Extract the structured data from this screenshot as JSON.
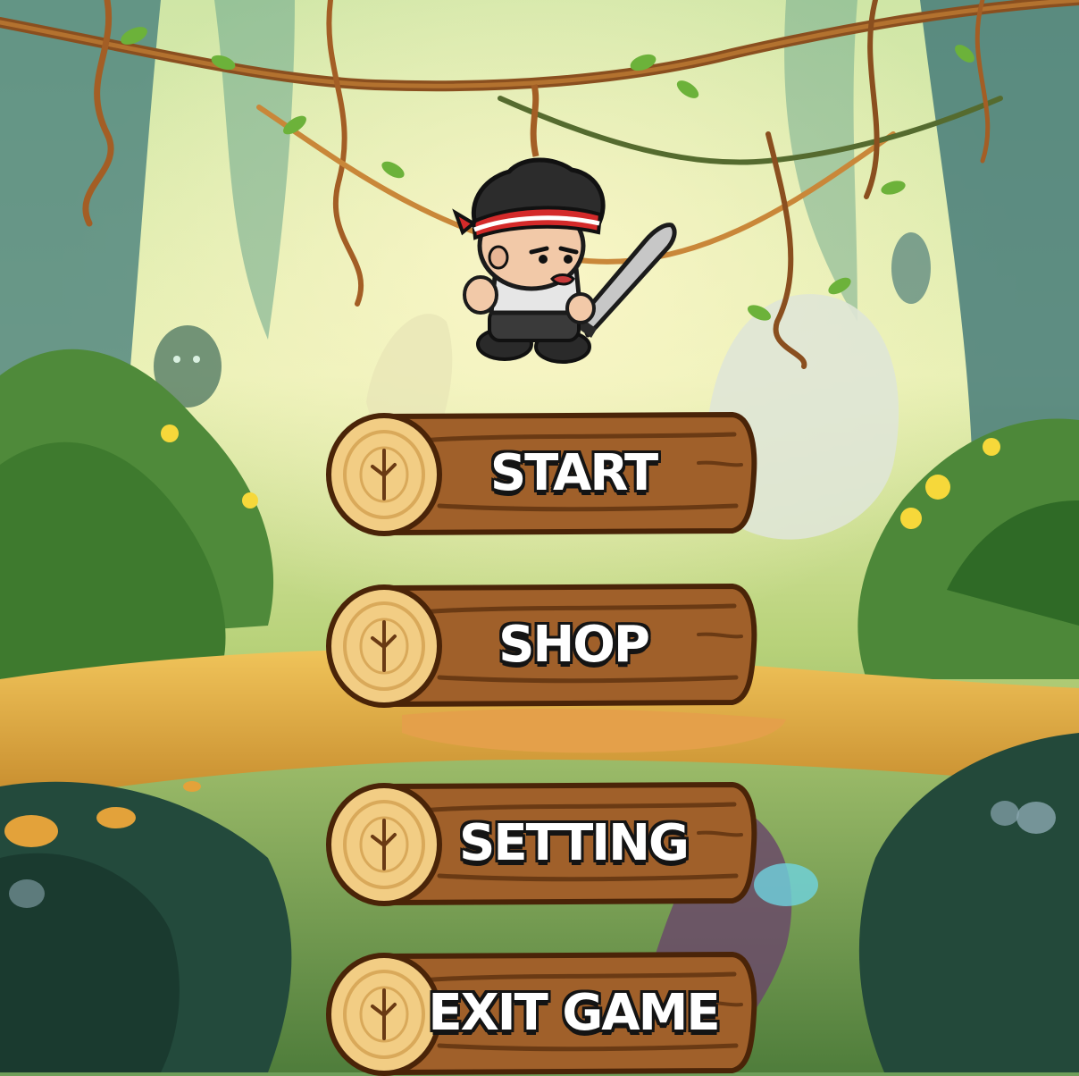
{
  "menu": {
    "start_label": "START",
    "shop_label": "SHOP",
    "setting_label": "SETTING",
    "exit_label": "EXIT GAME"
  },
  "colors": {
    "log_bark": "#a0602a",
    "log_bark_dark": "#6a3a14",
    "log_end_wood": "#f2cd84",
    "headband": "#d42a2a",
    "label_text": "#ffffff",
    "label_outline": "#141414"
  },
  "icons": {
    "character": "ninja-sword-character",
    "button_shape": "wooden-log"
  }
}
